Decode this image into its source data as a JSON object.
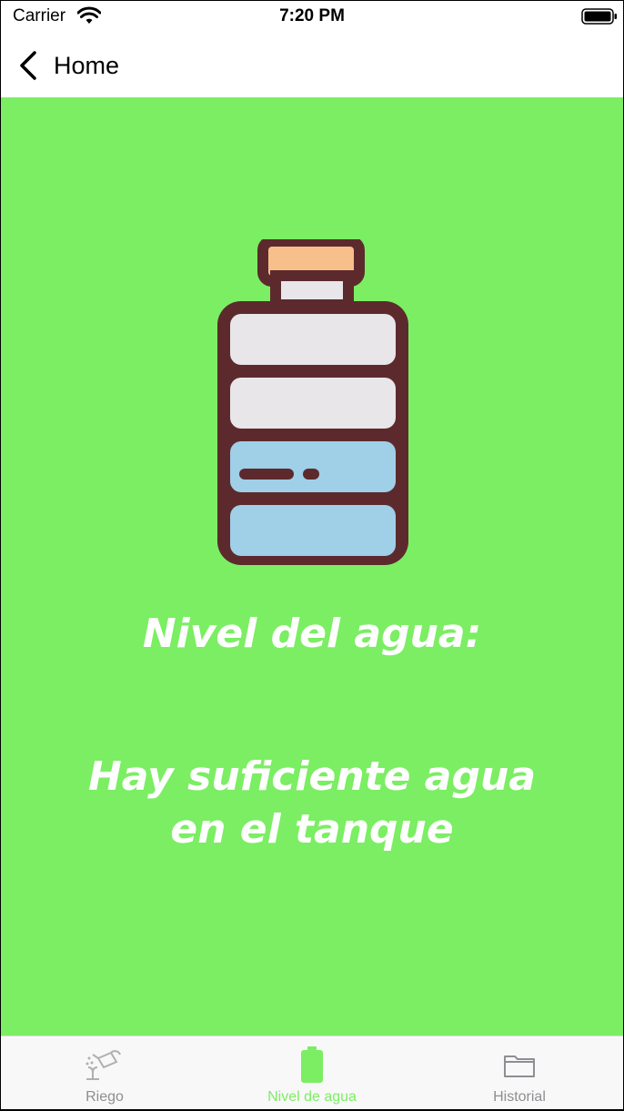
{
  "status_bar": {
    "carrier": "Carrier",
    "time": "7:20 PM"
  },
  "nav": {
    "back_label": "Home"
  },
  "main": {
    "background_color": "#7bee63",
    "icon": "water-bottle-icon",
    "title": "Nivel del agua:",
    "message": "Hay suficiente agua en el tanque"
  },
  "tab_bar": {
    "tabs": [
      {
        "label": "Riego",
        "icon": "watering-can-icon",
        "selected": false
      },
      {
        "label": "Nivel de agua",
        "icon": "battery-icon",
        "selected": true
      },
      {
        "label": "Historial",
        "icon": "folder-icon",
        "selected": false
      }
    ],
    "active_color": "#7bee63",
    "inactive_color": "#8e8e93"
  }
}
